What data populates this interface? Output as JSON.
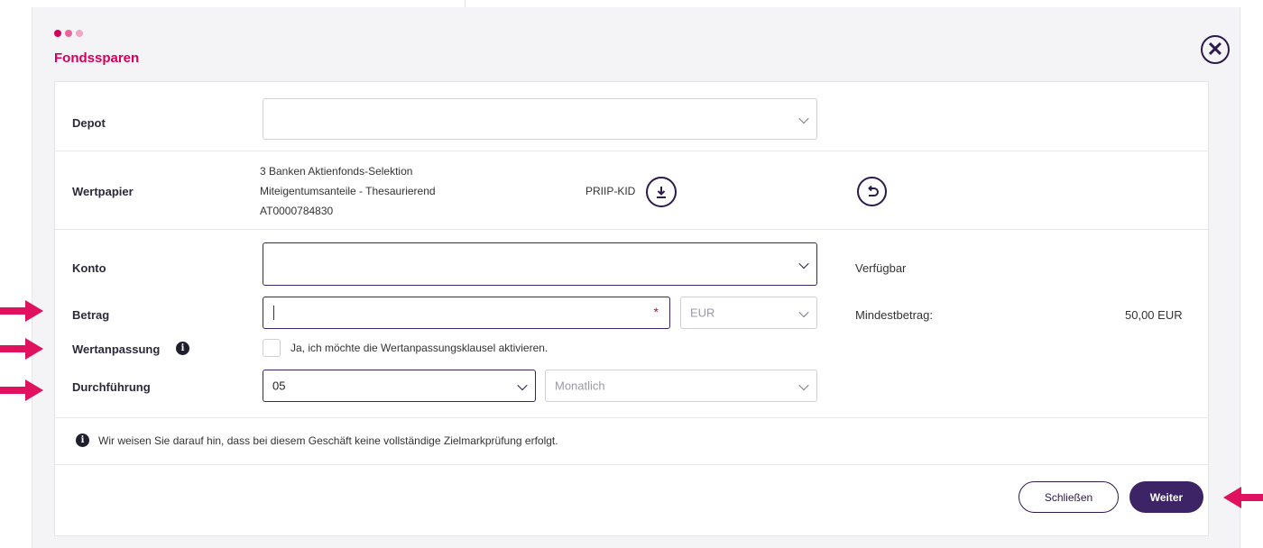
{
  "dialog": {
    "title": "Fondssparen",
    "close_icon": "close-circle-icon"
  },
  "depot": {
    "label": "Depot",
    "value": ""
  },
  "wertpapier": {
    "label": "Wertpapier",
    "name_line1": "3 Banken Aktienfonds-Selektion",
    "name_line2": "Miteigentumsanteile - Thesaurierend",
    "isin": "AT0000784830",
    "priip_label": "PRIIP-KID",
    "download_icon": "download-icon",
    "reset_icon": "undo-icon"
  },
  "konto": {
    "label": "Konto",
    "value": "",
    "verfuegbar_label": "Verfügbar"
  },
  "betrag": {
    "label": "Betrag",
    "value": "",
    "required_marker": "*",
    "currency": "EUR",
    "mindest_label": "Mindestbetrag:",
    "mindest_value": "50,00 EUR"
  },
  "wertanpassung": {
    "label": "Wertanpassung",
    "info_icon": "info-icon",
    "checkbox_label": "Ja, ich möchte die Wertanpassungsklausel aktivieren.",
    "checked": false
  },
  "durchfuehrung": {
    "label": "Durchführung",
    "day": "05",
    "interval": "Monatlich"
  },
  "notice": {
    "icon": "info-icon",
    "text": "Wir weisen Sie darauf hin, dass bei diesem Geschäft keine vollständige Zielmarkprüfung erfolgt."
  },
  "footer": {
    "close_label": "Schließen",
    "next_label": "Weiter"
  },
  "colors": {
    "accent": "#d4005a",
    "primary": "#3d2466",
    "annotation_arrow": "#e0115f"
  }
}
